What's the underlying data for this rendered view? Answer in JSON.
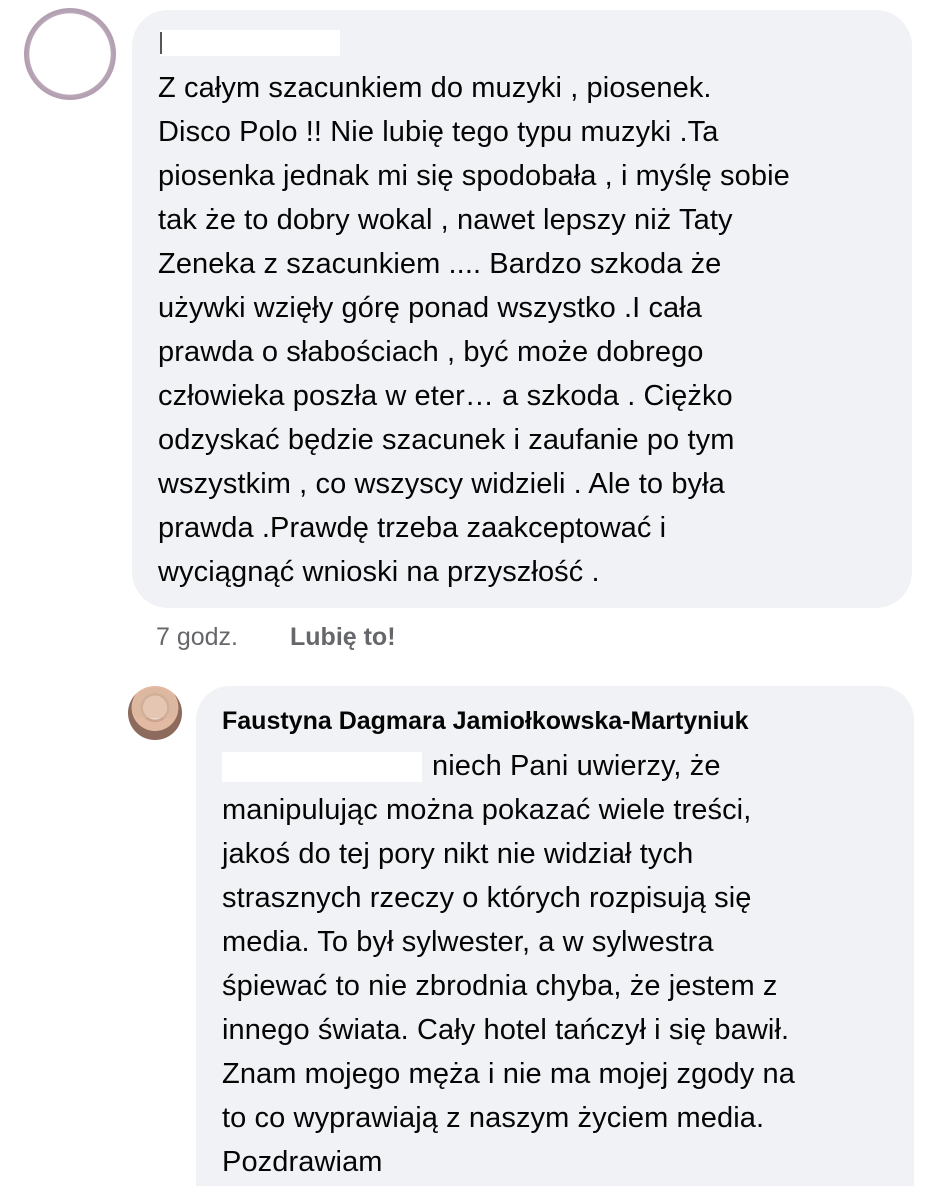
{
  "comment": {
    "author_name": "",
    "lines": [
      "Z całym szacunkiem do muzyki , piosenek.",
      "Disco  Polo !! Nie lubię tego typu muzyki .Ta",
      "piosenka jednak mi się spodobała , i myślę sobie",
      "tak że to dobry wokal , nawet lepszy niż Taty",
      "Zeneka  z szacunkiem .... Bardzo szkoda że",
      "używki wzięły górę ponad wszystko .I cała",
      "prawda o słabościach , być może dobrego",
      "człowieka poszła w eter… a szkoda  . Ciężko",
      "odzyskać będzie szacunek i zaufanie po tym",
      "wszystkim  , co wszyscy widzieli . Ale to była",
      "prawda .Prawdę trzeba zaakceptować i",
      "wyciągnąć wnioski na przyszłość ."
    ],
    "timestamp": "7 godz.",
    "like_label": "Lubię to!"
  },
  "reply": {
    "author_name": "Faustyna Dagmara Jamiołkowska-Martyniuk",
    "first_line": "niech Pani uwierzy, że",
    "lines": [
      "manipulując można pokazać wiele treści,",
      "jakoś do tej pory nikt nie widział tych",
      "strasznych rzeczy o których rozpisują się",
      "media. To był sylwester, a w sylwestra",
      "śpiewać to nie zbrodnia chyba, że jestem z",
      "innego świata. Cały hotel tańczył i się bawił.",
      "Znam mojego męża i nie ma mojej zgody na",
      "to co wyprawiają z naszym życiem media.",
      "Pozdrawiam"
    ]
  },
  "colors": {
    "bubble_background": "#f0f2f5",
    "meta_text": "#65676b",
    "body_text": "#050505"
  }
}
